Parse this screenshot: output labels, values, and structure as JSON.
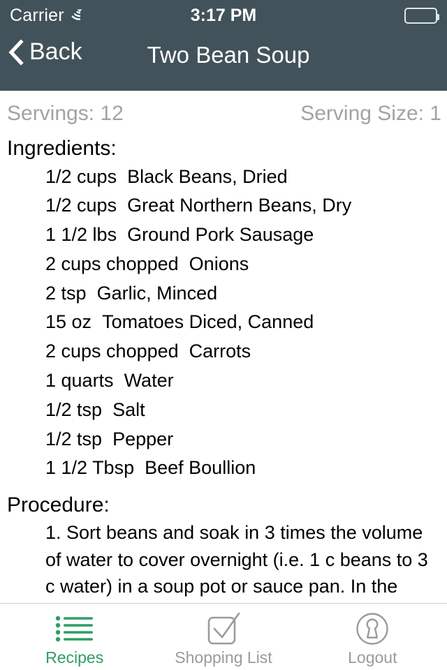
{
  "status_bar": {
    "carrier": "Carrier",
    "wifi_icon": "wifi-icon",
    "time": "3:17 PM",
    "battery_icon": "battery-full-icon"
  },
  "nav_bar": {
    "back_icon": "chevron-left-icon",
    "back_label": "Back",
    "title": "Two Bean Soup",
    "background_color": "#42525a"
  },
  "recipe": {
    "servings": "Servings: 12",
    "serving_size": "Serving Size: 1",
    "ingredients_heading": "Ingredients:",
    "ingredients": [
      {
        "quantity": "1/2 cups",
        "name": "Black Beans, Dried"
      },
      {
        "quantity": "1/2 cups",
        "name": "Great Northern Beans, Dry"
      },
      {
        "quantity": "1 1/2 lbs",
        "name": "Ground Pork Sausage"
      },
      {
        "quantity": "2 cups chopped",
        "name": "Onions"
      },
      {
        "quantity": "2 tsp",
        "name": "Garlic, Minced"
      },
      {
        "quantity": "15 oz",
        "name": "Tomatoes Diced, Canned"
      },
      {
        "quantity": "2 cups chopped",
        "name": "Carrots"
      },
      {
        "quantity": "1 quarts",
        "name": "Water"
      },
      {
        "quantity": "1/2 tsp",
        "name": "Salt"
      },
      {
        "quantity": "1/2 tsp",
        "name": "Pepper"
      },
      {
        "quantity": "1 1/2 Tbsp",
        "name": "Beef Boullion"
      }
    ],
    "procedure_heading": "Procedure:",
    "procedure_text": "1. Sort beans and soak in 3 times the volume of water to cover overnight (i.e. 1 c beans to 3 c water) in a soup pot or sauce pan. In the"
  },
  "tab_bar": {
    "active_color": "#2e9e63",
    "inactive_color": "#9b9b9b",
    "tabs": [
      {
        "label": "Recipes",
        "icon": "list-bullet-icon",
        "active": true
      },
      {
        "label": "Shopping List",
        "icon": "checkbox-check-icon",
        "active": false
      },
      {
        "label": "Logout",
        "icon": "keyhole-circle-icon",
        "active": false
      }
    ]
  }
}
